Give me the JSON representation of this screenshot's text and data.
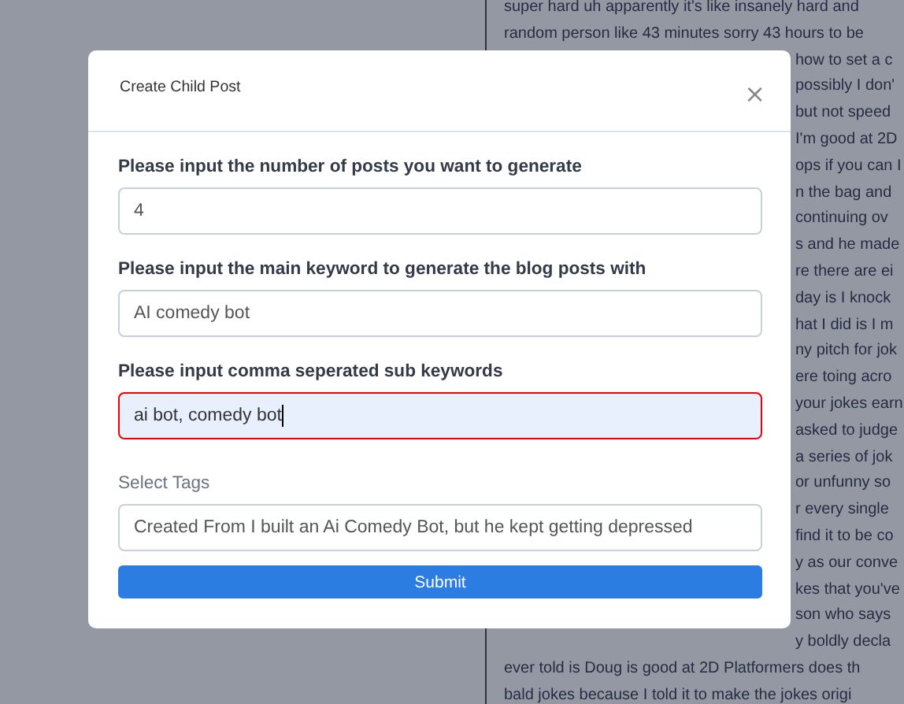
{
  "background_text": [
    {
      "text": "super hard uh apparently it's like insanely hard and",
      "kind": "full"
    },
    {
      "text": "random person like 43 minutes sorry 43 hours to be",
      "kind": "full"
    },
    {
      "text": "how to set a c",
      "kind": "partial"
    },
    {
      "text": "possibly I don'",
      "kind": "partial"
    },
    {
      "text": "but not speed",
      "kind": "partial"
    },
    {
      "text": "I'm good at 2D",
      "kind": "partial"
    },
    {
      "text": "ops if you can I",
      "kind": "partial"
    },
    {
      "text": "n the bag and",
      "kind": "partial"
    },
    {
      "text": "continuing ov",
      "kind": "partial"
    },
    {
      "text": "s and he made",
      "kind": "partial"
    },
    {
      "text": "re there are ei",
      "kind": "partial"
    },
    {
      "text": "day is I knock",
      "kind": "partial"
    },
    {
      "text": "hat I did is I m",
      "kind": "partial"
    },
    {
      "text": "ny pitch for jok",
      "kind": "partial"
    },
    {
      "text": "ere toing acro",
      "kind": "partial"
    },
    {
      "text": "your jokes earn",
      "kind": "partial"
    },
    {
      "text": "asked to judge",
      "kind": "partial"
    },
    {
      "text": "a series of jok",
      "kind": "partial"
    },
    {
      "text": "or unfunny so",
      "kind": "partial"
    },
    {
      "text": "r every single",
      "kind": "partial"
    },
    {
      "text": "find it to be co",
      "kind": "partial"
    },
    {
      "text": "y as our conve",
      "kind": "partial"
    },
    {
      "text": "kes that you've",
      "kind": "partial"
    },
    {
      "text": "son who says",
      "kind": "partial"
    },
    {
      "text": "y boldly decla",
      "kind": "partial"
    },
    {
      "text": "ever told is Doug is good at 2D Platformers does th",
      "kind": "full"
    },
    {
      "text": "bald jokes because I told it to make the jokes origi",
      "kind": "full"
    }
  ],
  "dialog": {
    "title": "Create Child Post",
    "close": "×",
    "fields": [
      {
        "label": "Please input the number of posts you want to generate",
        "value": "4",
        "label_bold": true,
        "focused": false
      },
      {
        "label": "Please input the main keyword to generate the blog posts with",
        "value": "AI comedy bot",
        "label_bold": true,
        "focused": false
      },
      {
        "label": "Please input comma seperated sub keywords",
        "value": "ai bot, comedy bot",
        "label_bold": true,
        "focused": true
      },
      {
        "label": "Select Tags",
        "value": "Created From I built an Ai Comedy Bot, but he kept getting depressed",
        "label_bold": false,
        "focused": false
      }
    ],
    "submit": "Submit"
  }
}
